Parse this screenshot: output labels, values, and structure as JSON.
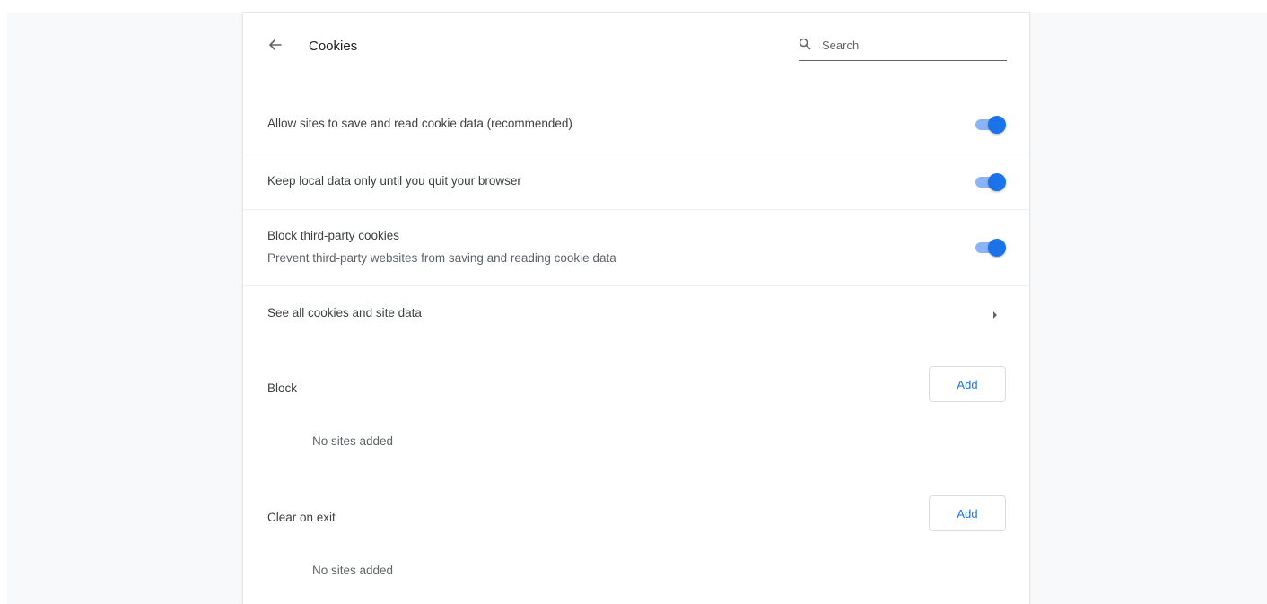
{
  "header": {
    "back_icon": "arrow-left-icon",
    "title": "Cookies",
    "search_icon": "search-icon",
    "search_placeholder": "Search",
    "search_value": ""
  },
  "settings": [
    {
      "label": "Allow sites to save and read cookie data (recommended)",
      "enabled": true
    },
    {
      "label": "Keep local data only until you quit your browser",
      "enabled": true
    },
    {
      "label": "Block third-party cookies",
      "sublabel": "Prevent third-party websites from saving and reading cookie data",
      "enabled": true
    }
  ],
  "see_all": {
    "label": "See all cookies and site data",
    "icon": "chevron-right-icon"
  },
  "block": {
    "label": "Block",
    "add_label": "Add",
    "empty_text": "No sites added"
  },
  "clear_on_exit": {
    "label": "Clear on exit",
    "add_label": "Add",
    "empty_text": "No sites added"
  },
  "colors": {
    "accent": "#1a73e8",
    "toggle_track": "#8ab4f8"
  }
}
